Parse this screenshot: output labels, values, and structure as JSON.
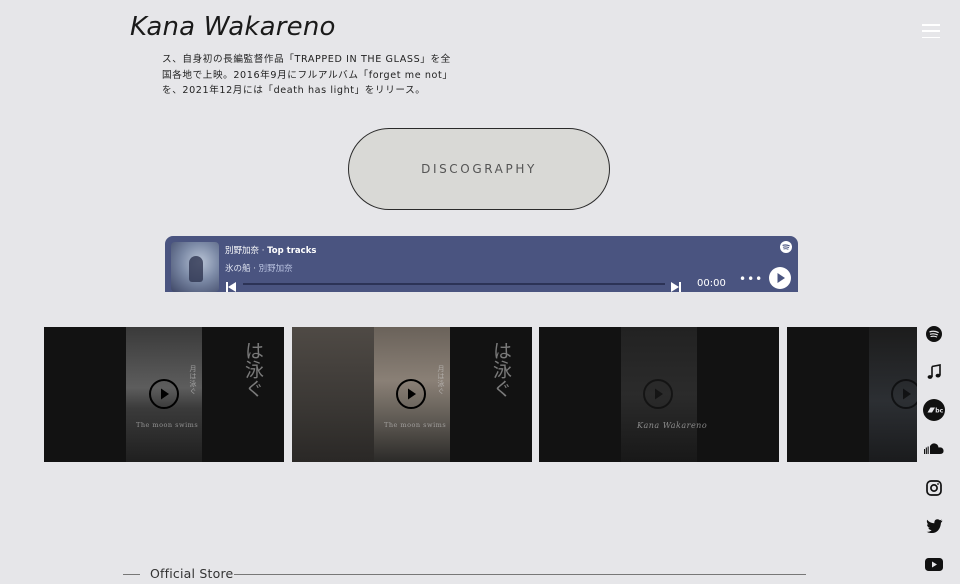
{
  "header": {
    "site_title": "Kana Wakareno"
  },
  "intro": {
    "lines": [
      "ス、自身初の長編監督作品「TRAPPED IN THE GLASS」を全",
      "国各地で上映。2016年9月にフルアルバム「forget me not」",
      "を、2021年12月には「death has light」をリリース。"
    ]
  },
  "discography_button": "DISCOGRAPHY",
  "player": {
    "artist": "別野加奈",
    "separator": " · ",
    "playlist": "Top tracks",
    "track": "氷の船",
    "track_artist": "別野加奈",
    "time": "00:00",
    "more": "•••",
    "accent_color": "#4a5480"
  },
  "videos": {
    "v1_kana": "は泳ぐ",
    "v1_small_title": "月は泳ぐ",
    "v1_caption": "The moon swims",
    "v2_kana": "は泳ぐ",
    "v2_small_title": "月は泳ぐ",
    "v2_caption": "The moon swims",
    "v3_script": "Kana Wakareno"
  },
  "social_icons": [
    "spotify-icon",
    "apple-music-icon",
    "bandcamp-icon",
    "soundcloud-icon",
    "instagram-icon",
    "twitter-icon",
    "youtube-icon"
  ],
  "store": {
    "label": "Official Store"
  }
}
